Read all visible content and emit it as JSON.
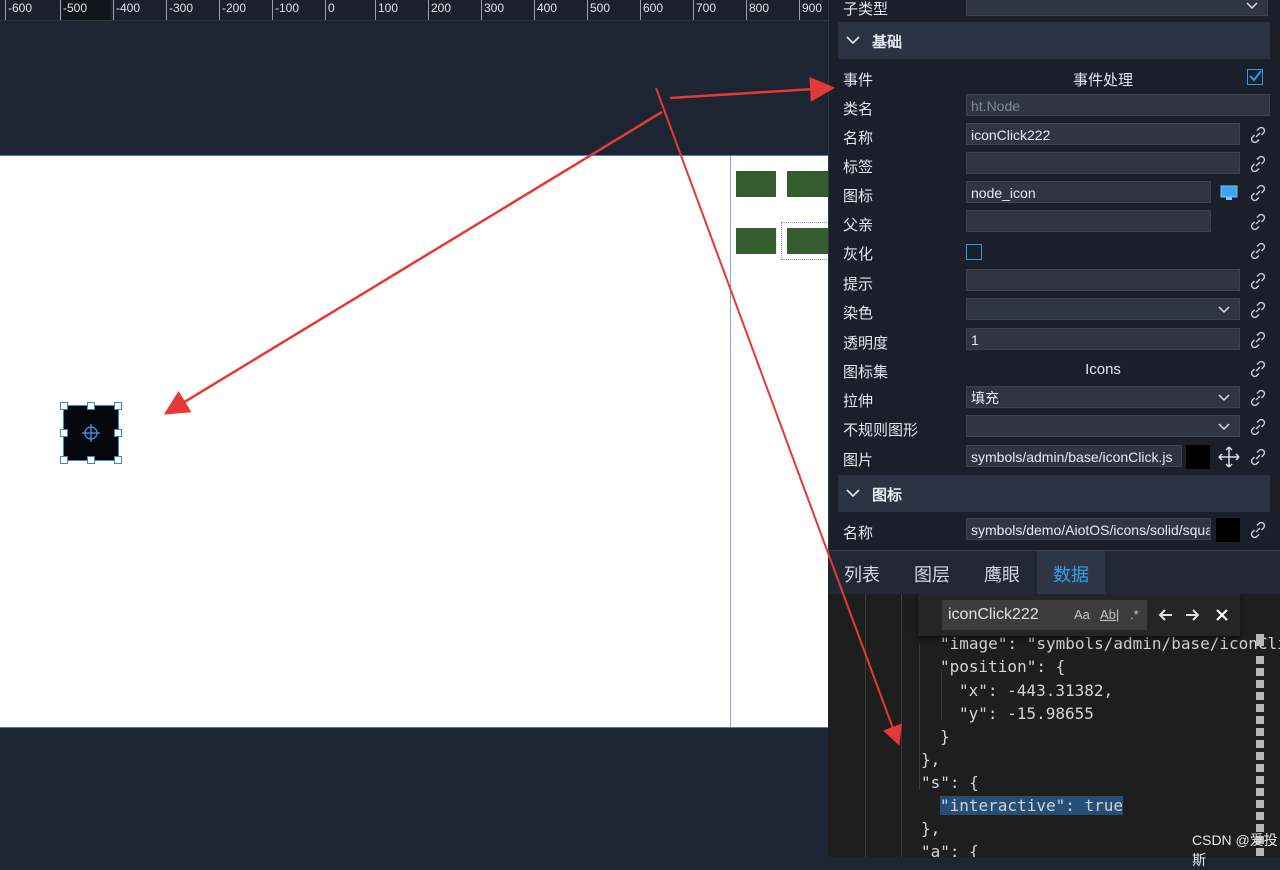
{
  "ruler": {
    "ticks": [
      "-600",
      "-500",
      "-400",
      "-300",
      "-200",
      "-100",
      "0",
      "100",
      "200",
      "300",
      "400",
      "500",
      "600",
      "700",
      "800",
      "900"
    ]
  },
  "panel": {
    "top_label": "子类型",
    "section_basic": "基础",
    "rows": {
      "event": {
        "label": "事件",
        "value": "事件处理"
      },
      "classname": {
        "label": "类名",
        "value": "ht.Node"
      },
      "name": {
        "label": "名称",
        "value": "iconClick222"
      },
      "tag": {
        "label": "标签",
        "value": ""
      },
      "icon": {
        "label": "图标",
        "value": "node_icon"
      },
      "parent": {
        "label": "父亲",
        "value": ""
      },
      "gray": {
        "label": "灰化"
      },
      "tooltip": {
        "label": "提示",
        "value": ""
      },
      "tint": {
        "label": "染色",
        "value": ""
      },
      "opacity": {
        "label": "透明度",
        "value": "1"
      },
      "iconset": {
        "label": "图标集",
        "value": "Icons"
      },
      "stretch": {
        "label": "拉伸",
        "value": "填充"
      },
      "irregular": {
        "label": "不规则图形",
        "value": ""
      },
      "image": {
        "label": "图片",
        "value": "symbols/admin/base/iconClick.js"
      }
    },
    "section_icon": "图标",
    "icon_name": {
      "label": "名称",
      "value": "symbols/demo/AiotOS/icons/solid/square.json"
    }
  },
  "tabs": [
    "列表",
    "图层",
    "鹰眼",
    "数据"
  ],
  "search": {
    "value": "iconClick222",
    "opt_case": "Aa",
    "opt_word": "Ab|",
    "opt_regex": ".*"
  },
  "code": {
    "l1": "\"image\": \"symbols/admin/base/iconClick.js\",",
    "l2": "\"position\": {",
    "l3": "\"x\": -443.31382,",
    "l4": "\"y\": -15.98655",
    "l5": "}",
    "l6": "},",
    "l7": "\"s\": {",
    "l8": "\"interactive\": true",
    "l9": "},",
    "l10": "\"a\": {"
  },
  "watermark": "CSDN @爱投斯",
  "colors": {
    "accent": "#2ea2f0",
    "annotation": "#e53935",
    "block_green": "#355d2f"
  }
}
